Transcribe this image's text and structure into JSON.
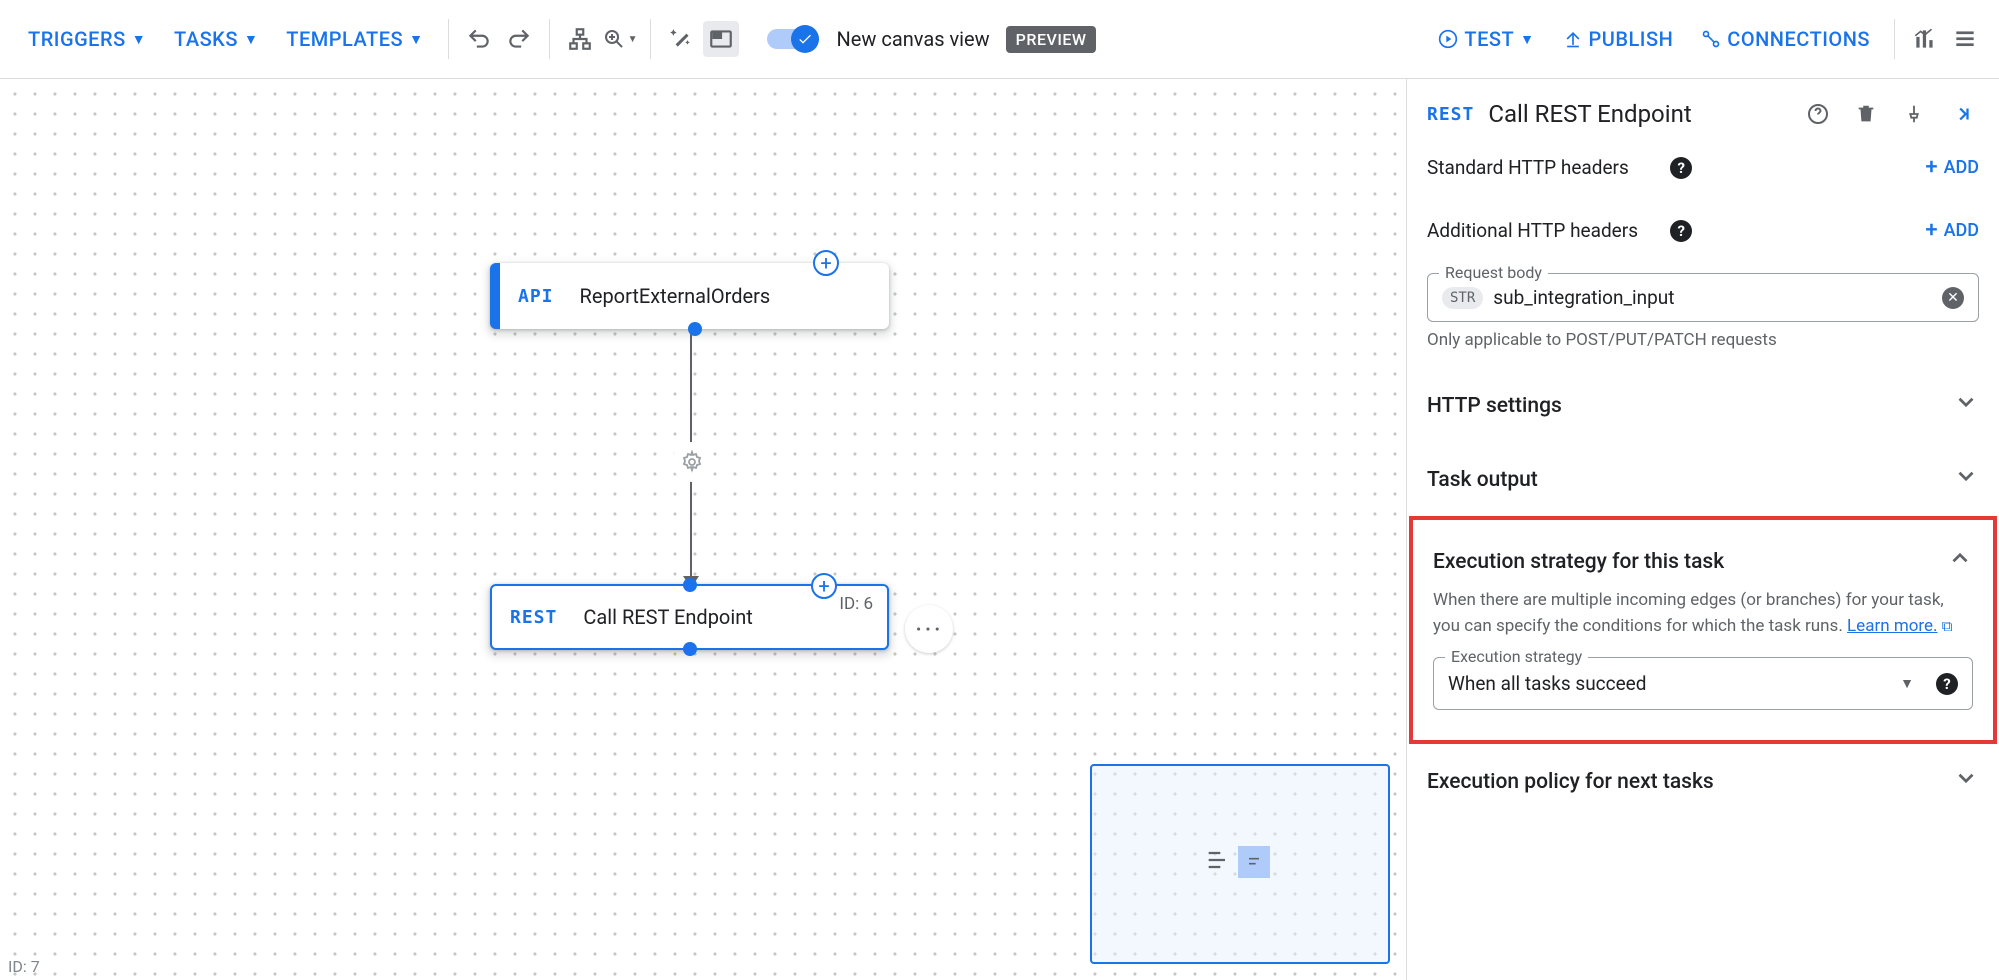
{
  "toolbar": {
    "triggers": "TRIGGERS",
    "tasks": "TASKS",
    "templates": "TEMPLATES",
    "canvasLabel": "New canvas view",
    "preview": "PREVIEW",
    "test": "TEST",
    "publish": "PUBLISH",
    "connections": "CONNECTIONS"
  },
  "canvas": {
    "triggerNode": {
      "tag": "API",
      "label": "ReportExternalOrders"
    },
    "taskNode": {
      "tag": "REST",
      "label": "Call REST Endpoint",
      "id": "ID: 6"
    },
    "footerId": "ID: 7"
  },
  "panel": {
    "tag": "REST",
    "title": "Call REST Endpoint",
    "stdHeaders": "Standard HTTP headers",
    "addHeaders": "Additional HTTP headers",
    "add": "ADD",
    "requestBody": {
      "legend": "Request body",
      "chip": "STR",
      "value": "sub_integration_input",
      "helper": "Only applicable to POST/PUT/PATCH requests"
    },
    "sections": {
      "http": "HTTP settings",
      "output": "Task output",
      "execStrategy": {
        "title": "Execution strategy for this task",
        "desc1": "When there are multiple incoming edges (or branches) for your task, you can specify the conditions for which the task runs. ",
        "learn": "Learn more.",
        "selectLegend": "Execution strategy",
        "selectValue": "When all tasks succeed"
      },
      "execPolicy": "Execution policy for next tasks"
    }
  }
}
